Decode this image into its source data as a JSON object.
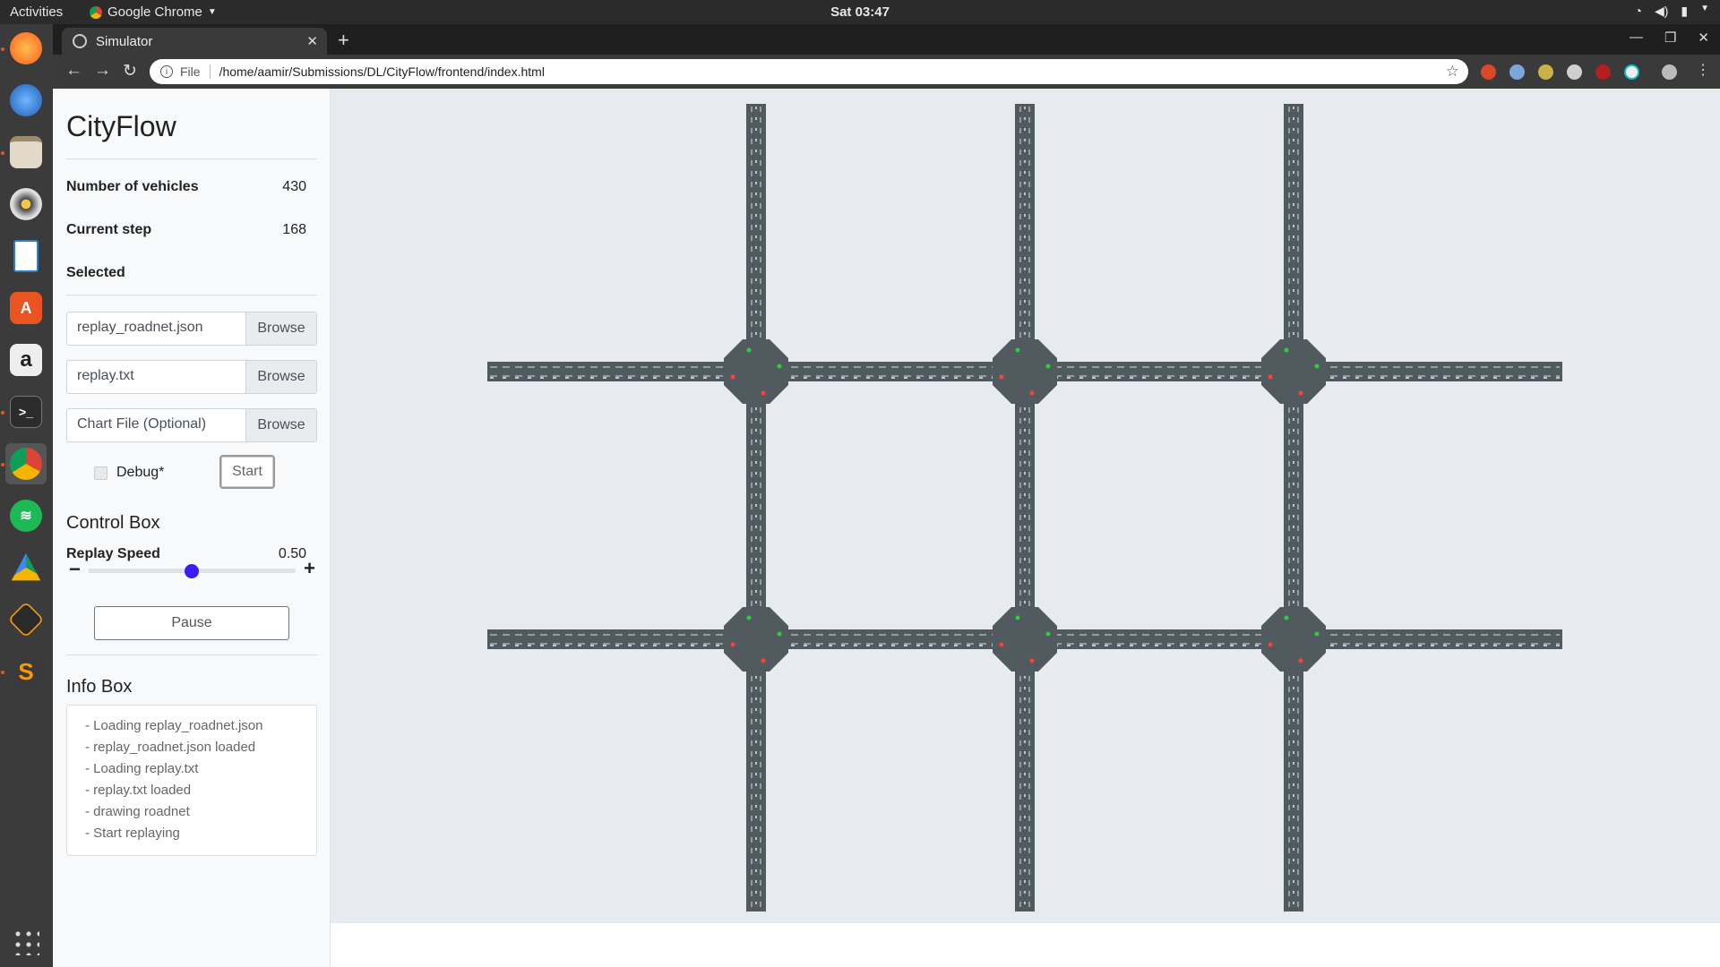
{
  "system": {
    "activities": "Activities",
    "app_name": "Google Chrome",
    "clock": "Sat 03:47"
  },
  "browser": {
    "tab_title": "Simulator",
    "url_scheme": "File",
    "url": "/home/aamir/Submissions/DL/CityFlow/frontend/index.html"
  },
  "app": {
    "title": "CityFlow",
    "stats": {
      "vehicles_label": "Number of vehicles",
      "vehicles_value": "430",
      "step_label": "Current step",
      "step_value": "168",
      "selected_label": "Selected"
    },
    "files": [
      {
        "name": "replay_roadnet.json",
        "button": "Browse"
      },
      {
        "name": "replay.txt",
        "button": "Browse"
      },
      {
        "name": "Chart File (Optional)",
        "button": "Browse"
      }
    ],
    "debug_label": "Debug*",
    "start_label": "Start",
    "control": {
      "title": "Control Box",
      "speed_label": "Replay Speed",
      "speed_value": "0.50",
      "slider_fraction": 0.5,
      "pause_label": "Pause"
    },
    "info": {
      "title": "Info Box",
      "lines": [
        "- Loading replay_roadnet.json",
        "- replay_roadnet.json loaded",
        "- Loading replay.txt",
        "- replay.txt loaded",
        "- drawing roadnet",
        "- Start replaying"
      ]
    }
  },
  "colors": {
    "road": "#515b5f",
    "canvas_bg": "#e7eaee",
    "lane_mark": "#d8dde0",
    "slider_thumb": "#3d1cf0"
  }
}
